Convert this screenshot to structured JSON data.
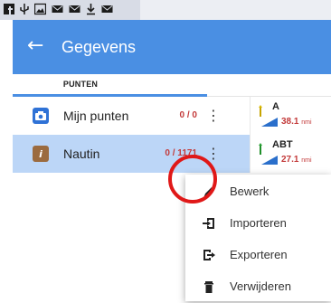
{
  "status_bar": {
    "icons": [
      "facebook-icon",
      "usb-icon",
      "image-icon",
      "mail-icon",
      "mail-icon",
      "download-icon",
      "mail-icon"
    ]
  },
  "app_bar": {
    "back_icon": "arrow-left-icon",
    "title": "Gegevens"
  },
  "tabs": [
    {
      "label": "PUNTEN",
      "active": true
    }
  ],
  "list": [
    {
      "name": "Mijn punten",
      "count": "0 / 0",
      "icon": "camera-icon"
    },
    {
      "name": "Nautin",
      "count": "0 / 1171",
      "icon": "info-icon"
    }
  ],
  "points": [
    {
      "name": "A",
      "distance": "38.1",
      "unit": "nmi"
    },
    {
      "name": "ABT",
      "distance": "27.1",
      "unit": "nmi"
    }
  ],
  "menu": {
    "items": [
      {
        "label": "Bewerk",
        "icon": "pencil-icon"
      },
      {
        "label": "Importeren",
        "icon": "import-icon"
      },
      {
        "label": "Exporteren",
        "icon": "export-icon"
      },
      {
        "label": "Verwijderen",
        "icon": "trash-icon"
      }
    ]
  },
  "colors": {
    "accent": "#4a8fe3",
    "selected_row": "#bcd6f7",
    "count_red": "#c33a3a",
    "highlight_circle": "#e01818"
  }
}
